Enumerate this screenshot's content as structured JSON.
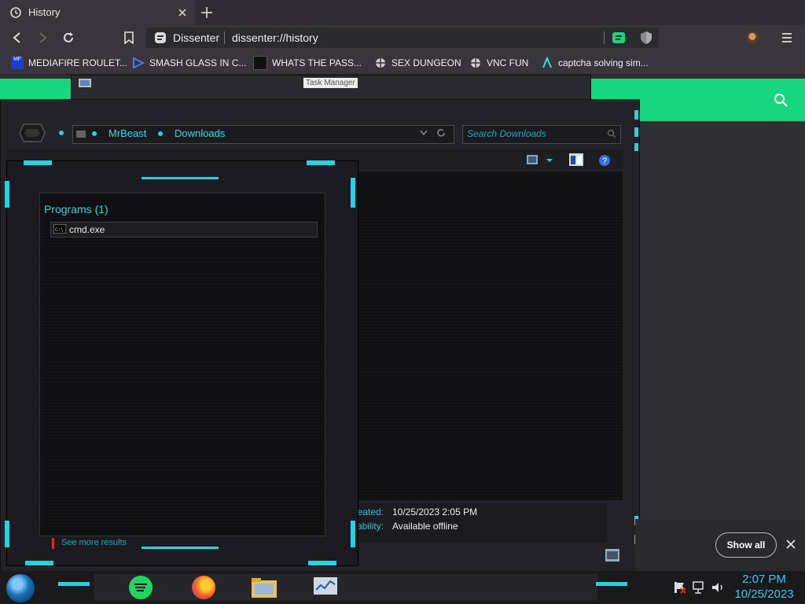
{
  "browser": {
    "tab_title": "History",
    "site_name": "Dissenter",
    "url": "dissenter://history",
    "icons": [
      "history-icon",
      "close-icon",
      "new-tab-icon",
      "back-icon",
      "forward-icon",
      "reload-icon",
      "bookmark-icon",
      "dissenter-icon",
      "bookmark-green-icon",
      "shield-icon",
      "avatar",
      "menu-icon"
    ]
  },
  "bookmarks": [
    {
      "label": "MEDIAFIRE ROULET..."
    },
    {
      "label": "SMASH GLASS IN C..."
    },
    {
      "label": "WHATS THE PASS..."
    },
    {
      "label": "SEX DUNGEON"
    },
    {
      "label": "VNC FUN"
    },
    {
      "label": "captcha solving sim..."
    }
  ],
  "explorer": {
    "tooltip": "Task Manager",
    "breadcrumb": [
      "MrBeast",
      "Downloads"
    ],
    "search_placeholder": "Search Downloads",
    "details": {
      "created_label": "Created:",
      "created_value": "10/25/2023 2:05 PM",
      "availability_label": "Availability:",
      "availability_value": "Available offline"
    }
  },
  "start_menu": {
    "group_title": "Programs (1)",
    "result": "cmd.exe",
    "see_more": "See more results"
  },
  "notification": {
    "show_all": "Show all"
  },
  "taskbar": {
    "time": "2:07 PM",
    "date": "10/25/2023",
    "apps": [
      "start-orb-icon",
      "spotify-icon",
      "firefox-icon",
      "explorer-icon",
      "taskmgr-icon"
    ]
  },
  "colors": {
    "accent_cyan": "#25d3e0",
    "brand_green": "#17d67d",
    "chrome_dark": "#38363c"
  }
}
